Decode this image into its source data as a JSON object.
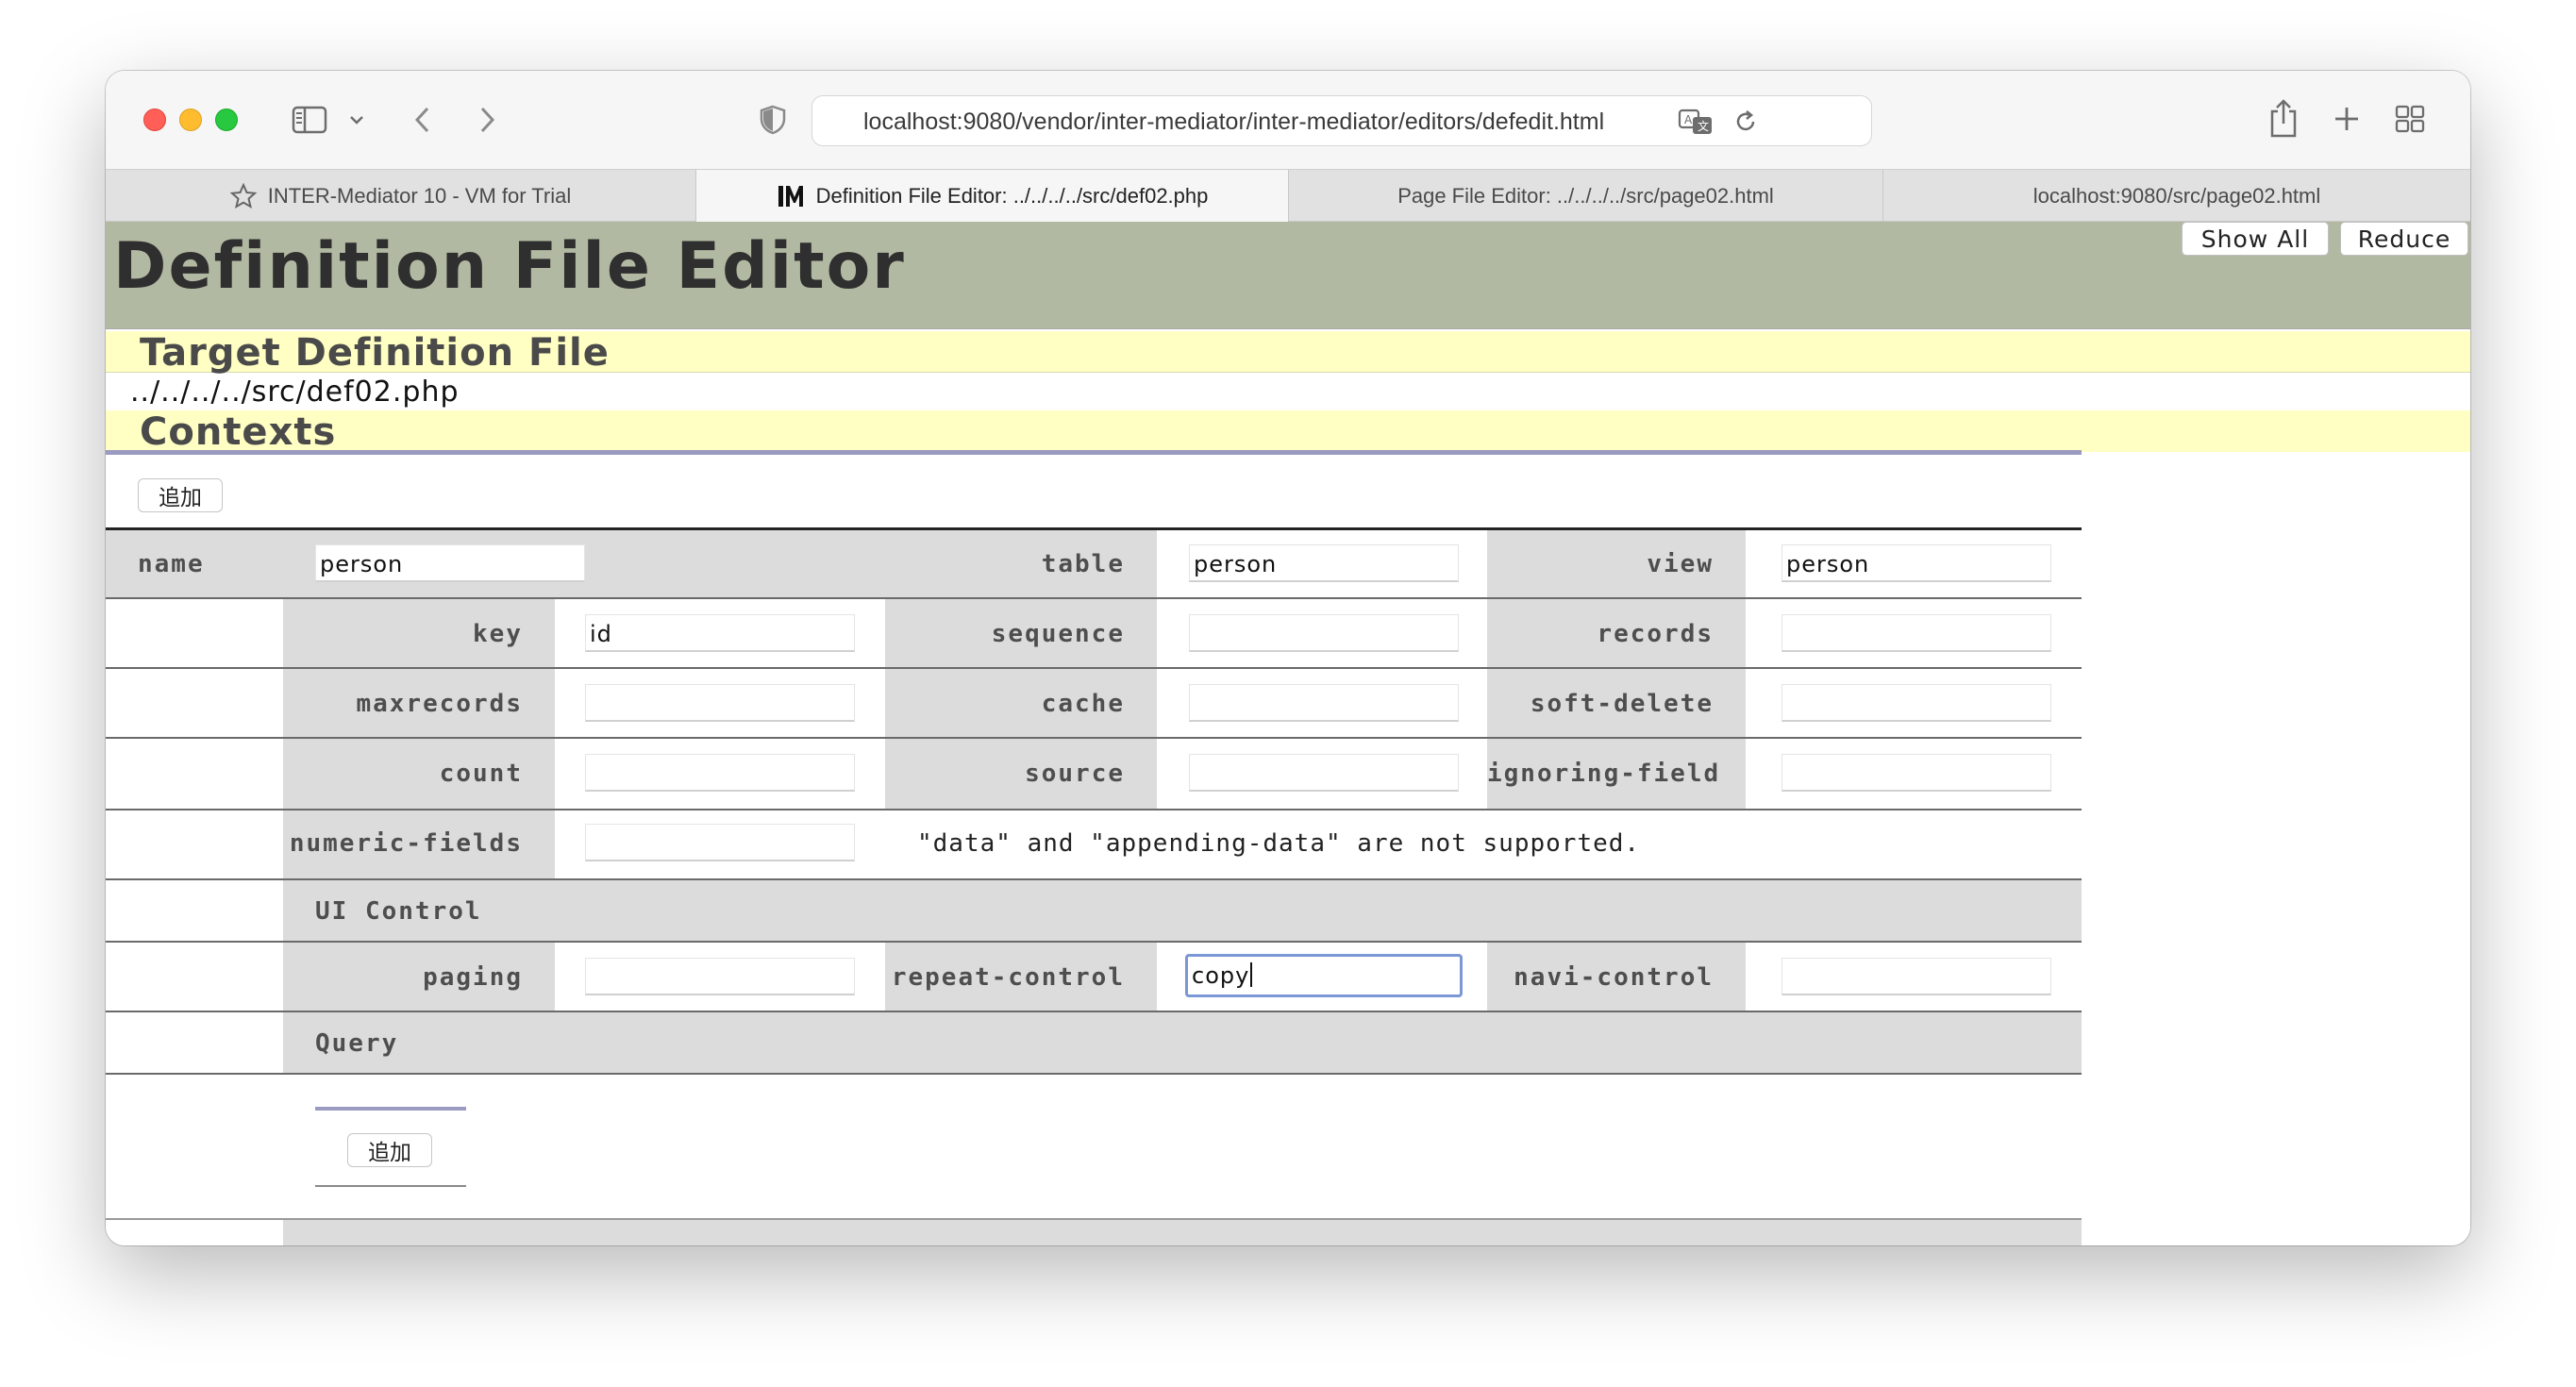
{
  "browser": {
    "url": "localhost:9080/vendor/inter-mediator/inter-mediator/editors/defedit.html",
    "tabs": [
      {
        "label": "INTER-Mediator 10 - VM for Trial",
        "icon": "star-icon"
      },
      {
        "label": "Definition File Editor: ../../../../src/def02.php",
        "icon": "im-logo-icon"
      },
      {
        "label": "Page File Editor: ../../../../src/page02.html",
        "icon": ""
      },
      {
        "label": "localhost:9080/src/page02.html",
        "icon": ""
      }
    ]
  },
  "header": {
    "title": "Definition File Editor",
    "show_all": "Show All",
    "reduce": "Reduce"
  },
  "target": {
    "heading": "Target Definition File",
    "path": "../../../../src/def02.php"
  },
  "contexts": {
    "heading": "Contexts",
    "add_label": "追加",
    "labels": {
      "name": "name",
      "table": "table",
      "view": "view",
      "key": "key",
      "sequence": "sequence",
      "records": "records",
      "maxrecords": "maxrecords",
      "cache": "cache",
      "soft_delete": "soft-delete",
      "count": "count",
      "source": "source",
      "ignoring_field": "ignoring-field",
      "numeric_fields": "numeric-fields",
      "ui_control": "UI Control",
      "paging": "paging",
      "repeat_control": "repeat-control",
      "navi_control": "navi-control",
      "query": "Query"
    },
    "values": {
      "name": "person",
      "table": "person",
      "view": "person",
      "key": "id",
      "sequence": "",
      "records": "",
      "maxrecords": "",
      "cache": "",
      "soft_delete": "",
      "count": "",
      "source": "",
      "ignoring_field": "",
      "numeric_fields": "",
      "paging": "",
      "repeat_control": "copy",
      "navi_control": ""
    },
    "note": "\"data\" and \"appending-data\" are not supported.",
    "query_add_label": "追加"
  }
}
